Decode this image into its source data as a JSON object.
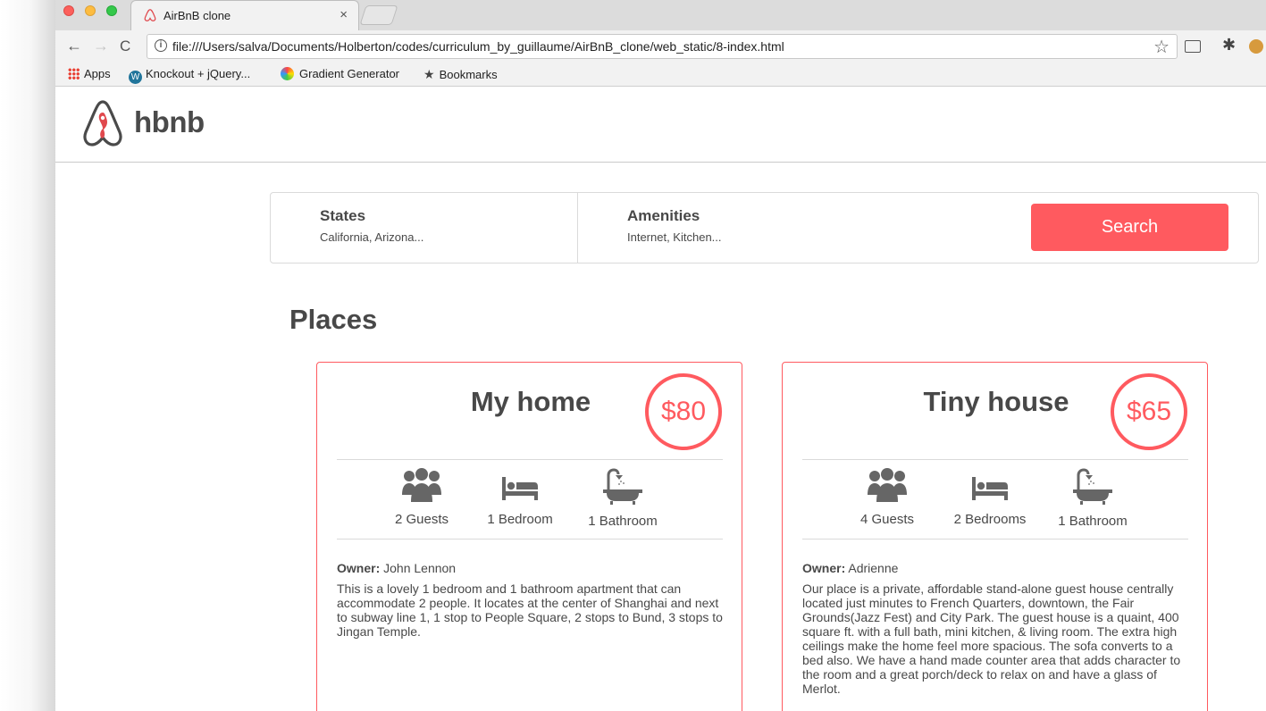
{
  "browser": {
    "tab_title": "AirBnB clone",
    "tab_close": "×",
    "url": "file:///Users/salva/Documents/Holberton/codes/curriculum_by_guillaume/AirBnB_clone/web_static/8-index.html",
    "nav": {
      "back": "←",
      "forward": "→",
      "reload": "C"
    },
    "star": "☆",
    "gear": "✱",
    "info": "i"
  },
  "bookmarks": [
    {
      "label": "Apps"
    },
    {
      "label": "Knockout + jQuery..."
    },
    {
      "label": "Gradient Generator"
    },
    {
      "label": "Bookmarks"
    }
  ],
  "header": {
    "logo_text": "hbnb"
  },
  "filters": {
    "states": {
      "title": "States",
      "value": "California, Arizona..."
    },
    "amenities": {
      "title": "Amenities",
      "value": "Internet, Kitchen..."
    },
    "search_label": "Search"
  },
  "places": {
    "title": "Places",
    "items": [
      {
        "title": "My home",
        "price": "$80",
        "guests": "2 Guests",
        "rooms": "1 Bedroom",
        "baths": "1 Bathroom",
        "owner_label": "Owner:",
        "owner": " John Lennon",
        "description": "This is a lovely 1 bedroom and 1 bathroom apartment that can accommodate 2 people. It locates at the center of Shanghai and next to subway line 1, 1 stop to People Square, 2 stops to Bund, 3 stops to Jingan Temple."
      },
      {
        "title": "Tiny house",
        "price": "$65",
        "guests": "4 Guests",
        "rooms": "2 Bedrooms",
        "baths": "1 Bathroom",
        "owner_label": "Owner:",
        "owner": " Adrienne",
        "description": "Our place is a private, affordable stand-alone guest house centrally located just minutes to French Quarters, downtown, the Fair Grounds(Jazz Fest) and City Park. The guest house is a quaint, 400 square ft. with a full bath, mini kitchen, & living room. The extra high ceilings make the home feel more spacious. The sofa converts to a bed also. We have a hand made counter area that adds character to the room and a great porch/deck to relax on and have a glass of Merlot."
      }
    ]
  },
  "colors": {
    "accent": "#ff5a5f",
    "text": "#484848",
    "border": "#dadada"
  },
  "icons": [
    "guests-icon",
    "bed-icon",
    "bath-icon",
    "airbnb-logo-icon",
    "star-icon",
    "gear-icon"
  ]
}
